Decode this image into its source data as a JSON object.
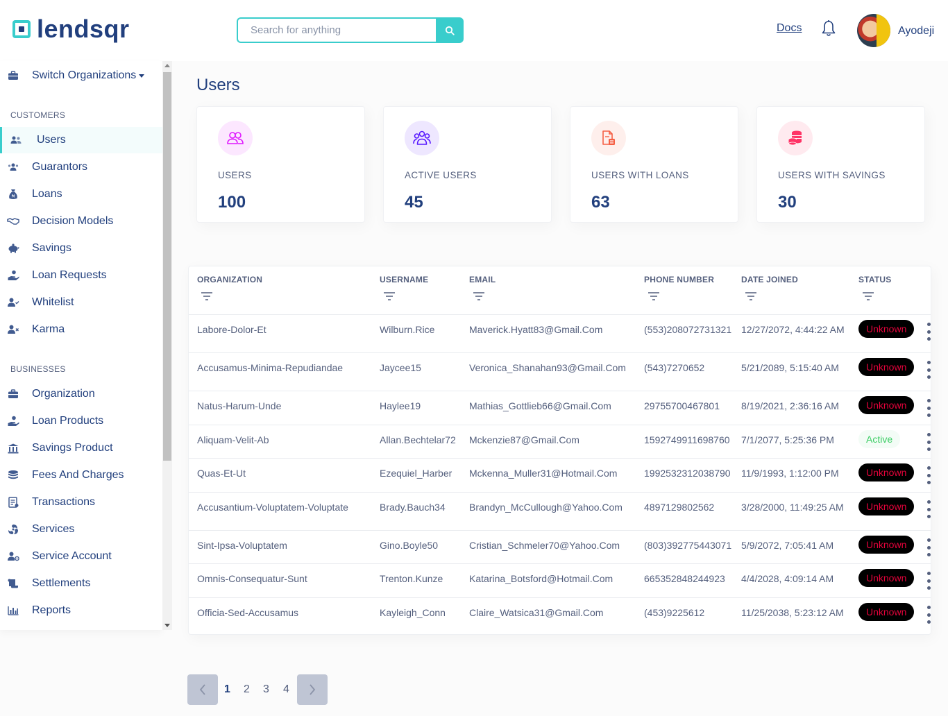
{
  "header": {
    "brand": "lendsqr",
    "search_placeholder": "Search for anything",
    "docs_label": "Docs",
    "user_name": "Ayodeji"
  },
  "sidebar": {
    "switch_org_label": "Switch Organizations",
    "customers_heading": "CUSTOMERS",
    "customers": [
      {
        "label": "Users",
        "icon": "users-icon"
      },
      {
        "label": "Guarantors",
        "icon": "guarantors-icon"
      },
      {
        "label": "Loans",
        "icon": "loan-bag-icon"
      },
      {
        "label": "Decision Models",
        "icon": "handshake-icon"
      },
      {
        "label": "Savings",
        "icon": "piggy-bank-icon"
      },
      {
        "label": "Loan Requests",
        "icon": "hand-coins-icon"
      },
      {
        "label": "Whitelist",
        "icon": "user-check-icon"
      },
      {
        "label": "Karma",
        "icon": "user-x-icon"
      }
    ],
    "businesses_heading": "BUSINESSES",
    "businesses": [
      {
        "label": "Organization",
        "icon": "briefcase-icon"
      },
      {
        "label": "Loan Products",
        "icon": "hand-coins-icon"
      },
      {
        "label": "Savings Product",
        "icon": "bank-icon"
      },
      {
        "label": "Fees And Charges",
        "icon": "coins-icon"
      },
      {
        "label": "Transactions",
        "icon": "transactions-icon"
      },
      {
        "label": "Services",
        "icon": "services-icon"
      },
      {
        "label": "Service Account",
        "icon": "user-cog-icon"
      },
      {
        "label": "Settlements",
        "icon": "scroll-icon"
      },
      {
        "label": "Reports",
        "icon": "chart-bar-icon"
      }
    ]
  },
  "main": {
    "title": "Users",
    "cards": [
      {
        "label": "USERS",
        "value": "100",
        "icon": "users-icon",
        "color": "#df18ff"
      },
      {
        "label": "ACTIVE USERS",
        "value": "45",
        "icon": "active-users-icon",
        "color": "#5718ff"
      },
      {
        "label": "USERS WITH LOANS",
        "value": "63",
        "icon": "loan-document-icon",
        "color": "#f55f44"
      },
      {
        "label": "USERS WITH SAVINGS",
        "value": "30",
        "icon": "coins-stack-icon",
        "color": "#ff3366"
      }
    ]
  },
  "table": {
    "headers": [
      "ORGANIZATION",
      "USERNAME",
      "EMAIL",
      "PHONE NUMBER",
      "DATE JOINED",
      "STATUS"
    ],
    "rows": [
      {
        "org": "Labore-Dolor-Et",
        "username": "Wilburn.Rice",
        "email": "Maverick.Hyatt83@Gmail.Com",
        "phone": "(553)208072731321",
        "date": "12/27/2072, 4:44:22 AM",
        "status": "Unknown"
      },
      {
        "org": "Accusamus-Minima-Repudiandae",
        "username": "Jaycee15",
        "email": "Veronica_Shanahan93@Gmail.Com",
        "phone": "(543)7270652",
        "date": "5/21/2089, 5:15:40 AM",
        "status": "Unknown"
      },
      {
        "org": "Natus-Harum-Unde",
        "username": "Haylee19",
        "email": "Mathias_Gottlieb66@Gmail.Com",
        "phone": "29755700467801",
        "date": "8/19/2021, 2:36:16 AM",
        "status": "Unknown"
      },
      {
        "org": "Aliquam-Velit-Ab",
        "username": "Allan.Bechtelar72",
        "email": "Mckenzie87@Gmail.Com",
        "phone": "1592749911698760",
        "date": "7/1/2077, 5:25:36 PM",
        "status": "Active"
      },
      {
        "org": "Quas-Et-Ut",
        "username": "Ezequiel_Harber",
        "email": "Mckenna_Muller31@Hotmail.Com",
        "phone": "1992532312038790",
        "date": "11/9/1993, 1:12:00 PM",
        "status": "Unknown"
      },
      {
        "org": "Accusantium-Voluptatem-Voluptate",
        "username": "Brady.Bauch34",
        "email": "Brandyn_McCullough@Yahoo.Com",
        "phone": "4897129802562",
        "date": "3/28/2000, 11:49:25 AM",
        "status": "Unknown"
      },
      {
        "org": "Sint-Ipsa-Voluptatem",
        "username": "Gino.Boyle50",
        "email": "Cristian_Schmeler70@Yahoo.Com",
        "phone": "(803)392775443071",
        "date": "5/9/2072, 7:05:41 AM",
        "status": "Unknown"
      },
      {
        "org": "Omnis-Consequatur-Sunt",
        "username": "Trenton.Kunze",
        "email": "Katarina_Botsford@Hotmail.Com",
        "phone": "665352848244923",
        "date": "4/4/2028, 4:09:14 AM",
        "status": "Unknown"
      },
      {
        "org": "Officia-Sed-Accusamus",
        "username": "Kayleigh_Conn",
        "email": "Claire_Watsica31@Gmail.Com",
        "phone": "(453)9225612",
        "date": "11/25/2038, 5:23:12 AM",
        "status": "Unknown"
      }
    ]
  },
  "pagination": {
    "pages": [
      "1",
      "2",
      "3",
      "4"
    ],
    "current": "1"
  },
  "colors": {
    "accent": "#39cdcc",
    "primary": "#213f7d",
    "muted": "#545f7d",
    "unknown_text": "#e4033b",
    "active_text": "#39cd62"
  }
}
